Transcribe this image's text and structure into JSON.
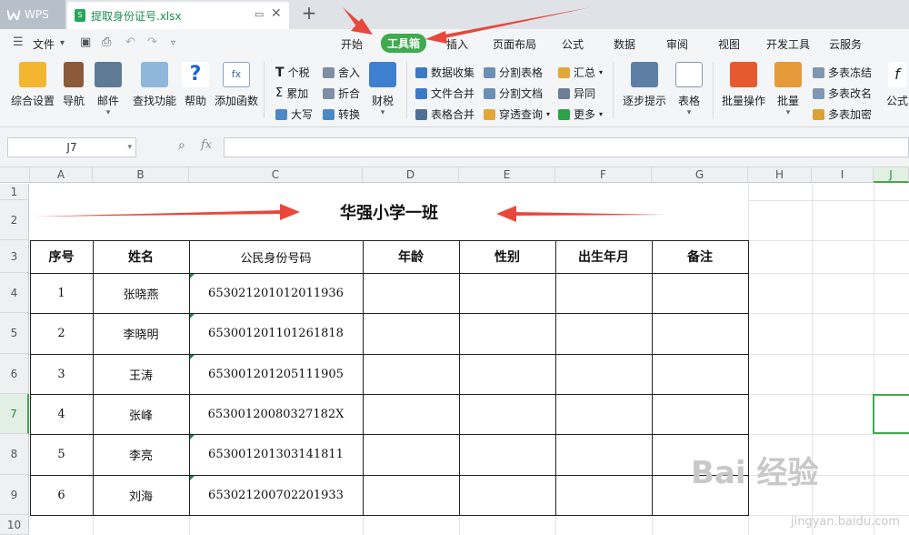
{
  "app": {
    "brand": "WPS",
    "file_tab": "提取身份证号.xlsx",
    "new_tab_glyph": "+"
  },
  "menu": {
    "file_label": "文件",
    "tabs": [
      "开始",
      "工具箱",
      "插入",
      "页面布局",
      "公式",
      "数据",
      "审阅",
      "视图",
      "开发工具",
      "云服务"
    ],
    "active_tab": "工具箱"
  },
  "ribbon": {
    "big": [
      "综合设置",
      "导航",
      "邮件",
      "查找功能",
      "帮助",
      "添加函数",
      "财税",
      "逐步提示",
      "表格",
      "批量操作",
      "批量",
      "公式"
    ],
    "small": [
      "个税",
      "舍入",
      "累加",
      "折合",
      "大写",
      "转换",
      "数据收集",
      "分割表格",
      "汇总",
      "文件合并",
      "分割文档",
      "异同",
      "表格合并",
      "穿透查询",
      "更多",
      "多表冻结",
      "多表改名",
      "多表加密"
    ]
  },
  "formula_bar": {
    "name_box": "J7",
    "fx_label": "fx",
    "formula": ""
  },
  "sheet": {
    "columns": [
      "A",
      "B",
      "C",
      "D",
      "E",
      "F",
      "G",
      "H",
      "I",
      "J"
    ],
    "rows": [
      "1",
      "2",
      "3",
      "4",
      "5",
      "6",
      "7",
      "8",
      "9",
      "10"
    ],
    "title": "华强小学一班",
    "headers": [
      "序号",
      "姓名",
      "公民身份号码",
      "年龄",
      "性别",
      "出生年月",
      "备注"
    ],
    "records": [
      {
        "no": "1",
        "name": "张晓燕",
        "id": "653021201012011936"
      },
      {
        "no": "2",
        "name": "李晓明",
        "id": "653001201101261818"
      },
      {
        "no": "3",
        "name": "王涛",
        "id": "653001201205111905"
      },
      {
        "no": "4",
        "name": "张峰",
        "id": "65300120080327182X"
      },
      {
        "no": "5",
        "name": "李亮",
        "id": "653001201303141811"
      },
      {
        "no": "6",
        "name": "刘海",
        "id": "653021200702201933"
      }
    ],
    "selected_cell": "J7"
  },
  "watermark": {
    "logo": "Bai 经验",
    "url": "jingyan.baidu.com"
  },
  "colors": {
    "accent_green": "#3faa4f",
    "arrow_red": "#e8483b"
  }
}
